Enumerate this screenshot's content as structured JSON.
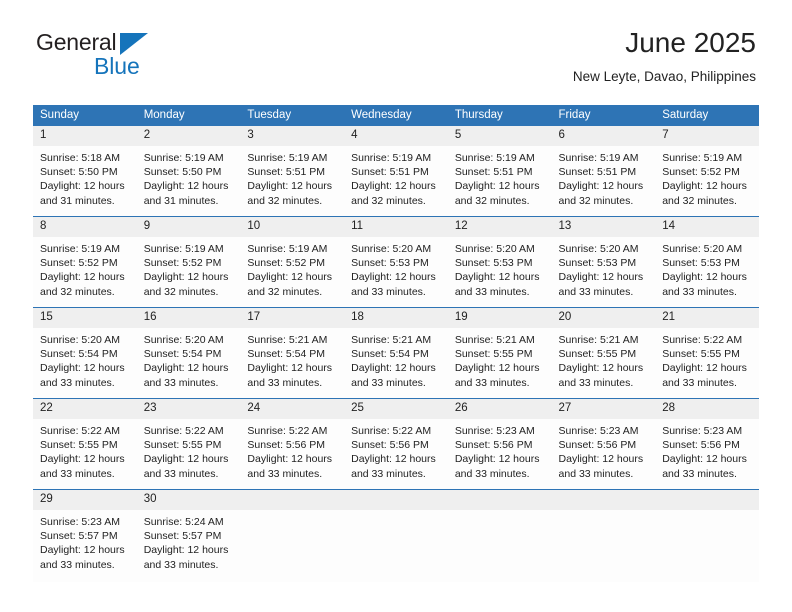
{
  "brand": {
    "name_part1": "General",
    "name_part2": "Blue",
    "accent_color": "#1574bb"
  },
  "header": {
    "title": "June 2025",
    "subtitle": "New Leyte, Davao, Philippines"
  },
  "theme": {
    "header_bg": "#2E74B5",
    "daynum_bg": "#EFEFEF",
    "text_color": "#222222"
  },
  "weekdays": [
    "Sunday",
    "Monday",
    "Tuesday",
    "Wednesday",
    "Thursday",
    "Friday",
    "Saturday"
  ],
  "labels": {
    "sunrise_prefix": "Sunrise:",
    "sunset_prefix": "Sunset:",
    "daylight_prefix": "Daylight:"
  },
  "weeks": [
    [
      {
        "day": "1",
        "sunrise": "Sunrise: 5:18 AM",
        "sunset": "Sunset: 5:50 PM",
        "daylight1": "Daylight: 12 hours",
        "daylight2": "and 31 minutes."
      },
      {
        "day": "2",
        "sunrise": "Sunrise: 5:19 AM",
        "sunset": "Sunset: 5:50 PM",
        "daylight1": "Daylight: 12 hours",
        "daylight2": "and 31 minutes."
      },
      {
        "day": "3",
        "sunrise": "Sunrise: 5:19 AM",
        "sunset": "Sunset: 5:51 PM",
        "daylight1": "Daylight: 12 hours",
        "daylight2": "and 32 minutes."
      },
      {
        "day": "4",
        "sunrise": "Sunrise: 5:19 AM",
        "sunset": "Sunset: 5:51 PM",
        "daylight1": "Daylight: 12 hours",
        "daylight2": "and 32 minutes."
      },
      {
        "day": "5",
        "sunrise": "Sunrise: 5:19 AM",
        "sunset": "Sunset: 5:51 PM",
        "daylight1": "Daylight: 12 hours",
        "daylight2": "and 32 minutes."
      },
      {
        "day": "6",
        "sunrise": "Sunrise: 5:19 AM",
        "sunset": "Sunset: 5:51 PM",
        "daylight1": "Daylight: 12 hours",
        "daylight2": "and 32 minutes."
      },
      {
        "day": "7",
        "sunrise": "Sunrise: 5:19 AM",
        "sunset": "Sunset: 5:52 PM",
        "daylight1": "Daylight: 12 hours",
        "daylight2": "and 32 minutes."
      }
    ],
    [
      {
        "day": "8",
        "sunrise": "Sunrise: 5:19 AM",
        "sunset": "Sunset: 5:52 PM",
        "daylight1": "Daylight: 12 hours",
        "daylight2": "and 32 minutes."
      },
      {
        "day": "9",
        "sunrise": "Sunrise: 5:19 AM",
        "sunset": "Sunset: 5:52 PM",
        "daylight1": "Daylight: 12 hours",
        "daylight2": "and 32 minutes."
      },
      {
        "day": "10",
        "sunrise": "Sunrise: 5:19 AM",
        "sunset": "Sunset: 5:52 PM",
        "daylight1": "Daylight: 12 hours",
        "daylight2": "and 32 minutes."
      },
      {
        "day": "11",
        "sunrise": "Sunrise: 5:20 AM",
        "sunset": "Sunset: 5:53 PM",
        "daylight1": "Daylight: 12 hours",
        "daylight2": "and 33 minutes."
      },
      {
        "day": "12",
        "sunrise": "Sunrise: 5:20 AM",
        "sunset": "Sunset: 5:53 PM",
        "daylight1": "Daylight: 12 hours",
        "daylight2": "and 33 minutes."
      },
      {
        "day": "13",
        "sunrise": "Sunrise: 5:20 AM",
        "sunset": "Sunset: 5:53 PM",
        "daylight1": "Daylight: 12 hours",
        "daylight2": "and 33 minutes."
      },
      {
        "day": "14",
        "sunrise": "Sunrise: 5:20 AM",
        "sunset": "Sunset: 5:53 PM",
        "daylight1": "Daylight: 12 hours",
        "daylight2": "and 33 minutes."
      }
    ],
    [
      {
        "day": "15",
        "sunrise": "Sunrise: 5:20 AM",
        "sunset": "Sunset: 5:54 PM",
        "daylight1": "Daylight: 12 hours",
        "daylight2": "and 33 minutes."
      },
      {
        "day": "16",
        "sunrise": "Sunrise: 5:20 AM",
        "sunset": "Sunset: 5:54 PM",
        "daylight1": "Daylight: 12 hours",
        "daylight2": "and 33 minutes."
      },
      {
        "day": "17",
        "sunrise": "Sunrise: 5:21 AM",
        "sunset": "Sunset: 5:54 PM",
        "daylight1": "Daylight: 12 hours",
        "daylight2": "and 33 minutes."
      },
      {
        "day": "18",
        "sunrise": "Sunrise: 5:21 AM",
        "sunset": "Sunset: 5:54 PM",
        "daylight1": "Daylight: 12 hours",
        "daylight2": "and 33 minutes."
      },
      {
        "day": "19",
        "sunrise": "Sunrise: 5:21 AM",
        "sunset": "Sunset: 5:55 PM",
        "daylight1": "Daylight: 12 hours",
        "daylight2": "and 33 minutes."
      },
      {
        "day": "20",
        "sunrise": "Sunrise: 5:21 AM",
        "sunset": "Sunset: 5:55 PM",
        "daylight1": "Daylight: 12 hours",
        "daylight2": "and 33 minutes."
      },
      {
        "day": "21",
        "sunrise": "Sunrise: 5:22 AM",
        "sunset": "Sunset: 5:55 PM",
        "daylight1": "Daylight: 12 hours",
        "daylight2": "and 33 minutes."
      }
    ],
    [
      {
        "day": "22",
        "sunrise": "Sunrise: 5:22 AM",
        "sunset": "Sunset: 5:55 PM",
        "daylight1": "Daylight: 12 hours",
        "daylight2": "and 33 minutes."
      },
      {
        "day": "23",
        "sunrise": "Sunrise: 5:22 AM",
        "sunset": "Sunset: 5:55 PM",
        "daylight1": "Daylight: 12 hours",
        "daylight2": "and 33 minutes."
      },
      {
        "day": "24",
        "sunrise": "Sunrise: 5:22 AM",
        "sunset": "Sunset: 5:56 PM",
        "daylight1": "Daylight: 12 hours",
        "daylight2": "and 33 minutes."
      },
      {
        "day": "25",
        "sunrise": "Sunrise: 5:22 AM",
        "sunset": "Sunset: 5:56 PM",
        "daylight1": "Daylight: 12 hours",
        "daylight2": "and 33 minutes."
      },
      {
        "day": "26",
        "sunrise": "Sunrise: 5:23 AM",
        "sunset": "Sunset: 5:56 PM",
        "daylight1": "Daylight: 12 hours",
        "daylight2": "and 33 minutes."
      },
      {
        "day": "27",
        "sunrise": "Sunrise: 5:23 AM",
        "sunset": "Sunset: 5:56 PM",
        "daylight1": "Daylight: 12 hours",
        "daylight2": "and 33 minutes."
      },
      {
        "day": "28",
        "sunrise": "Sunrise: 5:23 AM",
        "sunset": "Sunset: 5:56 PM",
        "daylight1": "Daylight: 12 hours",
        "daylight2": "and 33 minutes."
      }
    ],
    [
      {
        "day": "29",
        "sunrise": "Sunrise: 5:23 AM",
        "sunset": "Sunset: 5:57 PM",
        "daylight1": "Daylight: 12 hours",
        "daylight2": "and 33 minutes."
      },
      {
        "day": "30",
        "sunrise": "Sunrise: 5:24 AM",
        "sunset": "Sunset: 5:57 PM",
        "daylight1": "Daylight: 12 hours",
        "daylight2": "and 33 minutes."
      },
      {
        "day": "",
        "sunrise": "",
        "sunset": "",
        "daylight1": "",
        "daylight2": ""
      },
      {
        "day": "",
        "sunrise": "",
        "sunset": "",
        "daylight1": "",
        "daylight2": ""
      },
      {
        "day": "",
        "sunrise": "",
        "sunset": "",
        "daylight1": "",
        "daylight2": ""
      },
      {
        "day": "",
        "sunrise": "",
        "sunset": "",
        "daylight1": "",
        "daylight2": ""
      },
      {
        "day": "",
        "sunrise": "",
        "sunset": "",
        "daylight1": "",
        "daylight2": ""
      }
    ]
  ]
}
